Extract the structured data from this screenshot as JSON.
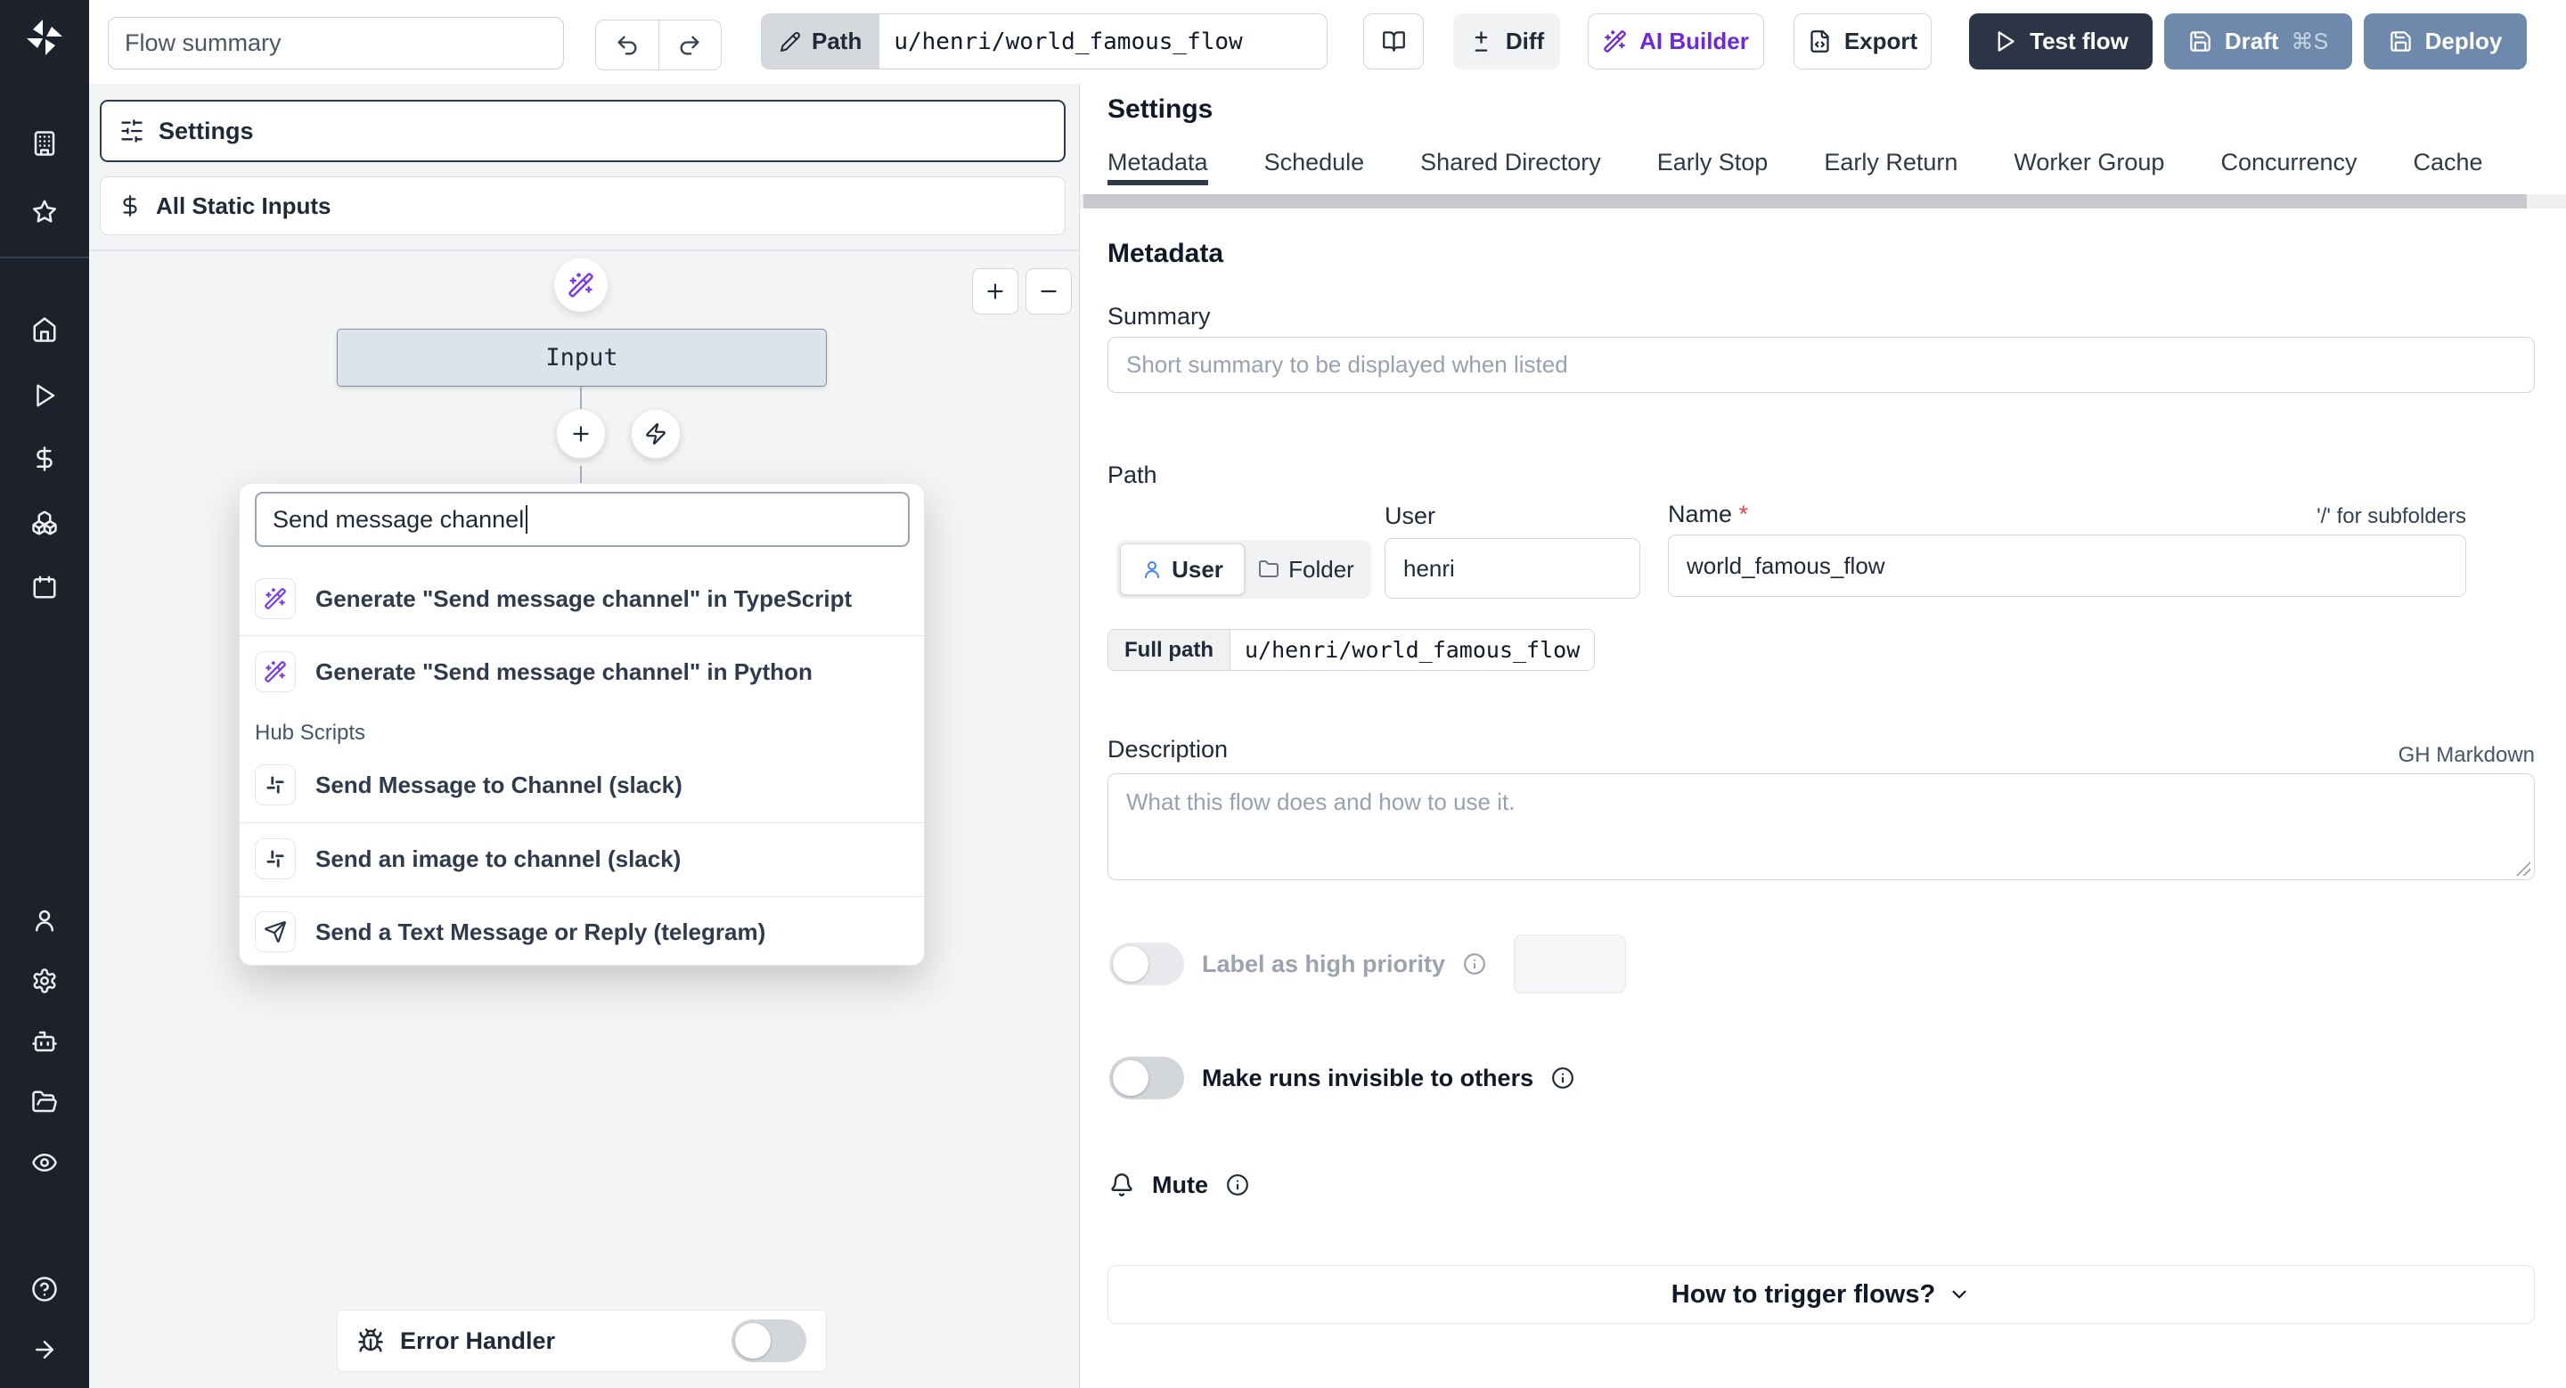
{
  "colors": {
    "sidebar_bg": "#1c212c",
    "canvas_bg": "#f3f4f6",
    "primary_text": "#1f2937",
    "dark_button": "#2c3545",
    "slate_button": "#6e89ab",
    "violet_accent": "#7c3aed",
    "blue_accent": "#3b82f6",
    "tab_underline": "#2f3947",
    "required_mark": "#ef4444"
  },
  "sidebar": {
    "icons": [
      "windmill-logo",
      "building",
      "star",
      "home",
      "play",
      "dollar",
      "boxes",
      "calendar",
      "user",
      "settings-gear",
      "bot",
      "folder-open",
      "eye",
      "help-circle",
      "collapse-arrow"
    ]
  },
  "topbar": {
    "flow_summary_placeholder": "Flow summary",
    "path_label": "Path",
    "path_value": "u/henri/world_famous_flow",
    "diff_label": "Diff",
    "ai_builder_label": "AI Builder",
    "export_label": "Export",
    "test_flow_label": "Test flow",
    "draft_label": "Draft",
    "draft_shortcut": "⌘S",
    "deploy_label": "Deploy"
  },
  "flow_panel": {
    "settings_label": "Settings",
    "static_inputs_label": "All Static Inputs",
    "input_node_label": "Input",
    "search_value": "Send message channel",
    "dropdown": {
      "generate_items": [
        {
          "label": "Generate \"Send message channel\" in TypeScript",
          "icon": "wand-sparkles-icon"
        },
        {
          "label": "Generate \"Send message channel\" in Python",
          "icon": "wand-sparkles-icon"
        }
      ],
      "section_label": "Hub Scripts",
      "hub_items": [
        {
          "label": "Send Message to Channel (slack)",
          "icon": "slack-icon"
        },
        {
          "label": "Send an image to channel (slack)",
          "icon": "slack-icon"
        },
        {
          "label": "Send a Text Message or Reply (telegram)",
          "icon": "telegram-icon"
        }
      ]
    },
    "error_handler_label": "Error Handler"
  },
  "settings_pane": {
    "title": "Settings",
    "active_tab": "Metadata",
    "tabs": [
      "Metadata",
      "Schedule",
      "Shared Directory",
      "Early Stop",
      "Early Return",
      "Worker Group",
      "Concurrency",
      "Cache"
    ],
    "metadata": {
      "heading": "Metadata",
      "summary_label": "Summary",
      "summary_placeholder": "Short summary to be displayed when listed",
      "path_label": "Path",
      "user_toggle_label": "User",
      "folder_toggle_label": "Folder",
      "user_label": "User",
      "user_value": "henri",
      "name_label": "Name",
      "required_mark": "*",
      "subfolder_hint": "'/' for subfolders",
      "name_value": "world_famous_flow",
      "full_path_label": "Full path",
      "full_path_value": "u/henri/world_famous_flow",
      "description_label": "Description",
      "markdown_hint": "GH Markdown",
      "description_placeholder": "What this flow does and how to use it.",
      "high_priority_label": "Label as high priority",
      "invisible_runs_label": "Make runs invisible to others",
      "mute_label": "Mute",
      "trigger_question": "How to trigger flows?"
    }
  }
}
